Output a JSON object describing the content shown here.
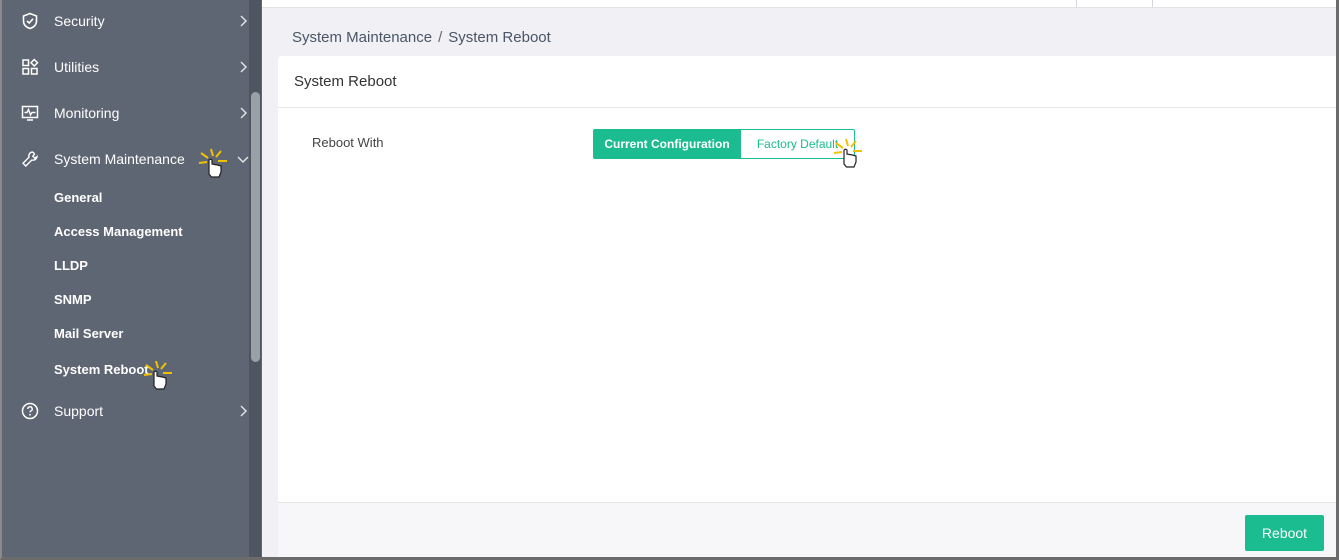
{
  "sidebar": {
    "items": [
      {
        "label": "Security",
        "icon": "shield-icon"
      },
      {
        "label": "Utilities",
        "icon": "utilities-grid-icon"
      },
      {
        "label": "Monitoring",
        "icon": "monitor-pulse-icon"
      },
      {
        "label": "System Maintenance",
        "icon": "wrench-icon"
      },
      {
        "label": "Support",
        "icon": "question-circle-icon"
      }
    ],
    "sub_items": [
      "General",
      "Access Management",
      "LLDP",
      "SNMP",
      "Mail Server",
      "System Reboot"
    ]
  },
  "breadcrumb": {
    "parent": "System Maintenance",
    "separator": "/",
    "current": "System Reboot"
  },
  "card": {
    "title": "System Reboot",
    "field_label": "Reboot With",
    "options": [
      "Current Configuration",
      "Factory Default"
    ],
    "selected": "Current Configuration"
  },
  "footer": {
    "reboot_label": "Reboot"
  },
  "colors": {
    "accent": "#1bbc8f",
    "sidebar_bg": "#5e6673",
    "cursor_highlight": "#f2c200"
  }
}
